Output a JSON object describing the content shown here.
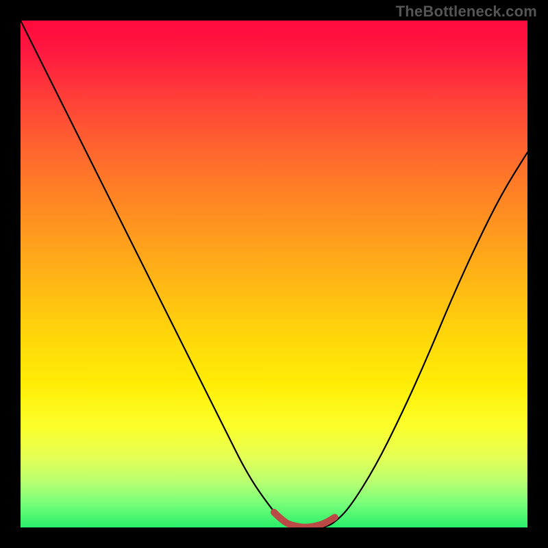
{
  "watermark": "TheBottleneck.com",
  "chart_data": {
    "type": "line",
    "title": "",
    "xlabel": "",
    "ylabel": "",
    "xlim": [
      0,
      100
    ],
    "ylim": [
      0,
      100
    ],
    "grid": false,
    "legend": false,
    "gradient_colors": {
      "top": "#ff0a3c",
      "mid_high": "#ff9a1e",
      "mid_low": "#ffee06",
      "bottom": "#28ef6a"
    },
    "series": [
      {
        "name": "bottleneck-curve",
        "color": "#000000",
        "x": [
          0,
          5,
          10,
          15,
          20,
          25,
          30,
          35,
          40,
          45,
          50,
          52,
          55,
          58,
          60,
          62,
          65,
          70,
          75,
          80,
          85,
          90,
          95,
          100
        ],
        "values": [
          100,
          90,
          80,
          70,
          60,
          50,
          40,
          30,
          20,
          10,
          3,
          1,
          0,
          0,
          0,
          1,
          4,
          12,
          22,
          33,
          45,
          56,
          66,
          74
        ]
      },
      {
        "name": "flat-valley-highlight",
        "color": "#b94a45",
        "x": [
          50,
          52,
          54,
          56,
          58,
          60,
          62
        ],
        "values": [
          3,
          1,
          0.3,
          0,
          0.2,
          0.8,
          2
        ]
      }
    ]
  }
}
